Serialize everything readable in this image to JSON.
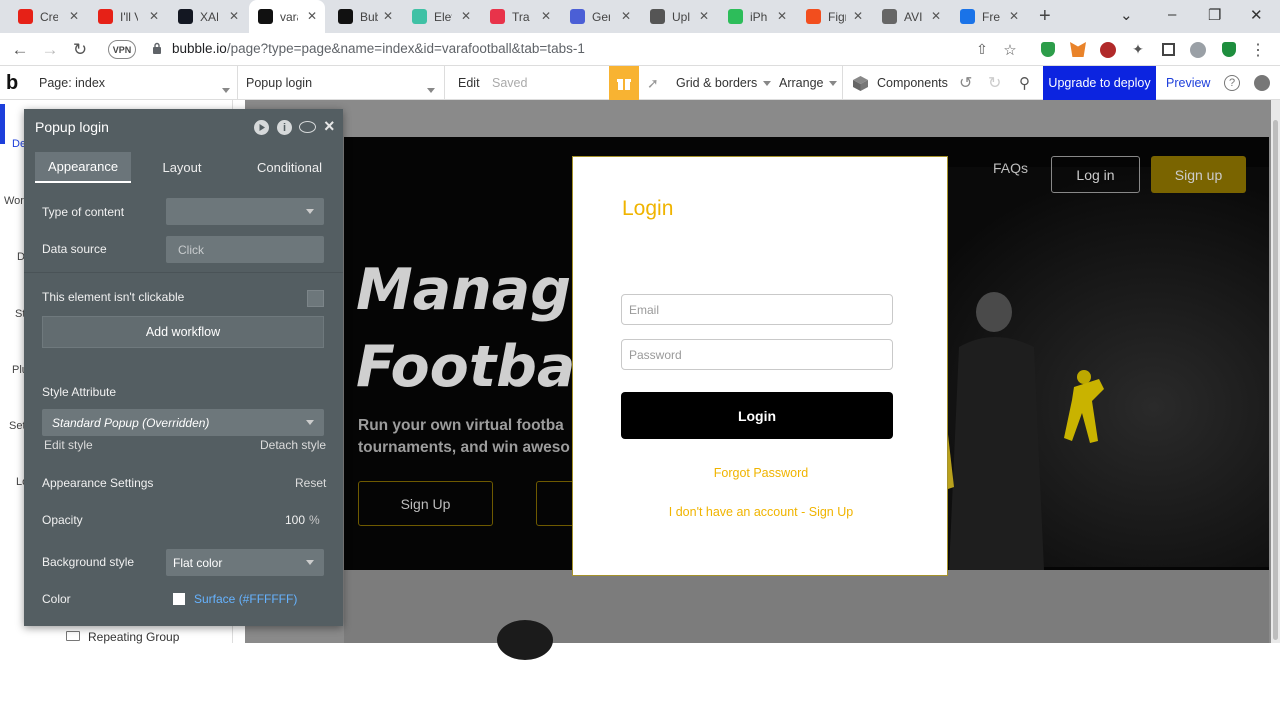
{
  "browser": {
    "tabs": [
      {
        "title": "Cre",
        "icon": "youtube-icon",
        "color": "#e62117"
      },
      {
        "title": "I'll V",
        "icon": "youtube-icon",
        "color": "#e62117"
      },
      {
        "title": "XAL",
        "icon": "tradingview-icon",
        "color": "#131722"
      },
      {
        "title": "vara",
        "icon": "bubble-icon",
        "color": "#111111"
      },
      {
        "title": "Bub",
        "icon": "bubble-icon",
        "color": "#111111"
      },
      {
        "title": "Elev",
        "icon": "elevenlabs-icon",
        "color": "#3fc1a5"
      },
      {
        "title": "Trad",
        "icon": "trading-icon",
        "color": "#e8334a"
      },
      {
        "title": "Gen",
        "icon": "grammarly-icon",
        "color": "#4b5fd6"
      },
      {
        "title": "Upl",
        "icon": "upload-icon",
        "color": "#555555"
      },
      {
        "title": "iPh",
        "icon": "m-icon",
        "color": "#2dbd5a"
      },
      {
        "title": "Figr",
        "icon": "figma-icon",
        "color": "#f24e1e"
      },
      {
        "title": "AVI",
        "icon": "cloud-icon",
        "color": "#666666"
      },
      {
        "title": "Fre",
        "icon": "globe-icon",
        "color": "#1a73e8"
      }
    ],
    "new_tab": "+",
    "url_host": "bubble.io",
    "url_path": "/page?type=page&name=index&id=varafootball&tab=tabs-1",
    "vpn_label": "VPN"
  },
  "editor": {
    "page_label": "Page: index",
    "element_select": "Popup login",
    "edit_label": "Edit",
    "saved_label": "Saved",
    "grid_label": "Grid & borders",
    "arrange_label": "Arrange",
    "components_label": "Components",
    "upgrade_label": "Upgrade to deploy",
    "preview_label": "Preview",
    "side_partial": [
      "De",
      "Wor",
      "D",
      "St",
      "Plu",
      "Set",
      "Lo"
    ],
    "repeating_group": "Repeating Group"
  },
  "panel": {
    "title": "Popup login",
    "tabs": [
      "Appearance",
      "Layout",
      "Conditional"
    ],
    "type_of_content_label": "Type of content",
    "type_of_content_value": "",
    "data_source_label": "Data source",
    "data_source_placeholder": "Click",
    "clickable_label": "This element isn't clickable",
    "add_workflow": "Add workflow",
    "style_attribute_label": "Style Attribute",
    "style_value": "Standard Popup (Overridden)",
    "edit_style": "Edit style",
    "detach_style": "Detach style",
    "appearance_settings": "Appearance Settings",
    "reset": "Reset",
    "opacity_label": "Opacity",
    "opacity_value": "100",
    "opacity_unit": "%",
    "background_style_label": "Background style",
    "background_style_value": "Flat color",
    "color_label": "Color",
    "color_value": "Surface (#FFFFFF)"
  },
  "site": {
    "nav": {
      "faqs": "FAQs",
      "login": "Log in",
      "signup": "Sign up"
    },
    "hero_line1": "Manage",
    "hero_line2": "Football",
    "sub_line1": "Run your own virtual footba",
    "sub_line2": "tournaments, and win aweso",
    "hero_signup": "Sign Up"
  },
  "popup": {
    "title": "Login",
    "email_placeholder": "Email",
    "password_placeholder": "Password",
    "login_button": "Login",
    "forgot": "Forgot Password",
    "signup_link": "I don't have an account - Sign Up"
  },
  "colors": {
    "accent_yellow": "#f0b400",
    "upgrade_blue": "#0c24e0",
    "panel_bg": "#545e62",
    "link_blue": "#66b3ff"
  }
}
